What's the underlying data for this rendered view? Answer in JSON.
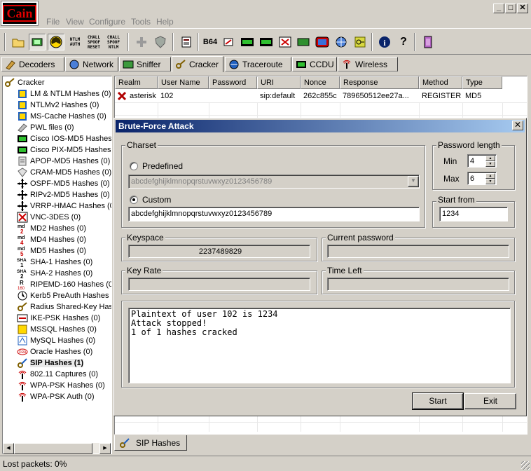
{
  "app": {
    "logo_text": "Cain"
  },
  "menu": [
    "File",
    "View",
    "Configure",
    "Tools",
    "Help"
  ],
  "window_controls": {
    "minimize": "_",
    "maximize": "□",
    "close": "✕"
  },
  "toolbar": {
    "ntlm_auth": "NTLM AUTH",
    "chall_spoof_reset": "CHALL SPOOF RESET",
    "chall_spoof_ntlm": "CHALL SPOOF NTLM",
    "base64": "B64"
  },
  "tabs": [
    {
      "label": "Decoders",
      "icon": "decoders-icon"
    },
    {
      "label": "Network",
      "icon": "network-icon"
    },
    {
      "label": "Sniffer",
      "icon": "sniffer-icon"
    },
    {
      "label": "Cracker",
      "icon": "cracker-icon",
      "active": true
    },
    {
      "label": "Traceroute",
      "icon": "traceroute-icon"
    },
    {
      "label": "CCDU",
      "icon": "ccdu-icon"
    },
    {
      "label": "Wireless",
      "icon": "wireless-icon"
    }
  ],
  "tree": {
    "root": "Cracker",
    "items": [
      "LM & NTLM Hashes (0)",
      "NTLMv2 Hashes (0)",
      "MS-Cache Hashes (0)",
      "PWL files (0)",
      "Cisco IOS-MD5 Hashes",
      "Cisco PIX-MD5 Hashes",
      "APOP-MD5 Hashes (0)",
      "CRAM-MD5 Hashes (0)",
      "OSPF-MD5 Hashes (0)",
      "RIPv2-MD5 Hashes (0)",
      "VRRP-HMAC Hashes (0",
      "VNC-3DES (0)",
      "MD2 Hashes (0)",
      "MD4 Hashes (0)",
      "MD5 Hashes (0)",
      "SHA-1 Hashes (0)",
      "SHA-2 Hashes (0)",
      "RIPEMD-160 Hashes (0",
      "Kerb5 PreAuth Hashes",
      "Radius Shared-Key Has",
      "IKE-PSK Hashes (0)",
      "MSSQL Hashes (0)",
      "MySQL Hashes (0)",
      "Oracle Hashes (0)",
      "SIP Hashes (1)",
      "802.11 Captures (0)",
      "WPA-PSK Hashes (0)",
      "WPA-PSK Auth (0)"
    ],
    "selected_index": 24
  },
  "table": {
    "columns": [
      "Realm",
      "User Name",
      "Password",
      "URI",
      "Nonce",
      "Response",
      "Method",
      "Type"
    ],
    "rows": [
      {
        "realm": "asterisk",
        "user": "102",
        "password": "",
        "uri": "sip:default",
        "nonce": "262c855c",
        "response": "789650512ee27a...",
        "method": "REGISTER",
        "type": "MD5"
      }
    ]
  },
  "dialog": {
    "title": "Brute-Force Attack",
    "charset": {
      "label": "Charset",
      "predefined_label": "Predefined",
      "predefined_value": "abcdefghijklmnopqrstuvwxyz0123456789",
      "custom_label": "Custom",
      "custom_value": "abcdefghijklmnopqrstuvwxyz0123456789"
    },
    "password_length": {
      "label": "Password length",
      "min_label": "Min",
      "min_value": "4",
      "max_label": "Max",
      "max_value": "6"
    },
    "start_from": {
      "label": "Start from",
      "value": "1234"
    },
    "keyspace": {
      "label": "Keyspace",
      "value": "2237489829"
    },
    "current_password": {
      "label": "Current password",
      "value": ""
    },
    "key_rate": {
      "label": "Key Rate",
      "value": ""
    },
    "time_left": {
      "label": "Time Left",
      "value": ""
    },
    "log": [
      "Plaintext of user 102 is 1234",
      "Attack stopped!",
      "1 of 1 hashes cracked"
    ],
    "start_button": "Start",
    "exit_button": "Exit"
  },
  "bottom_tab": {
    "label": "SIP Hashes"
  },
  "status": {
    "text": "Lost packets:  0%"
  },
  "colors": {
    "title_bar_start": "#0a246a",
    "title_bar_end": "#a6caf0",
    "logo_red": "#e00000"
  }
}
